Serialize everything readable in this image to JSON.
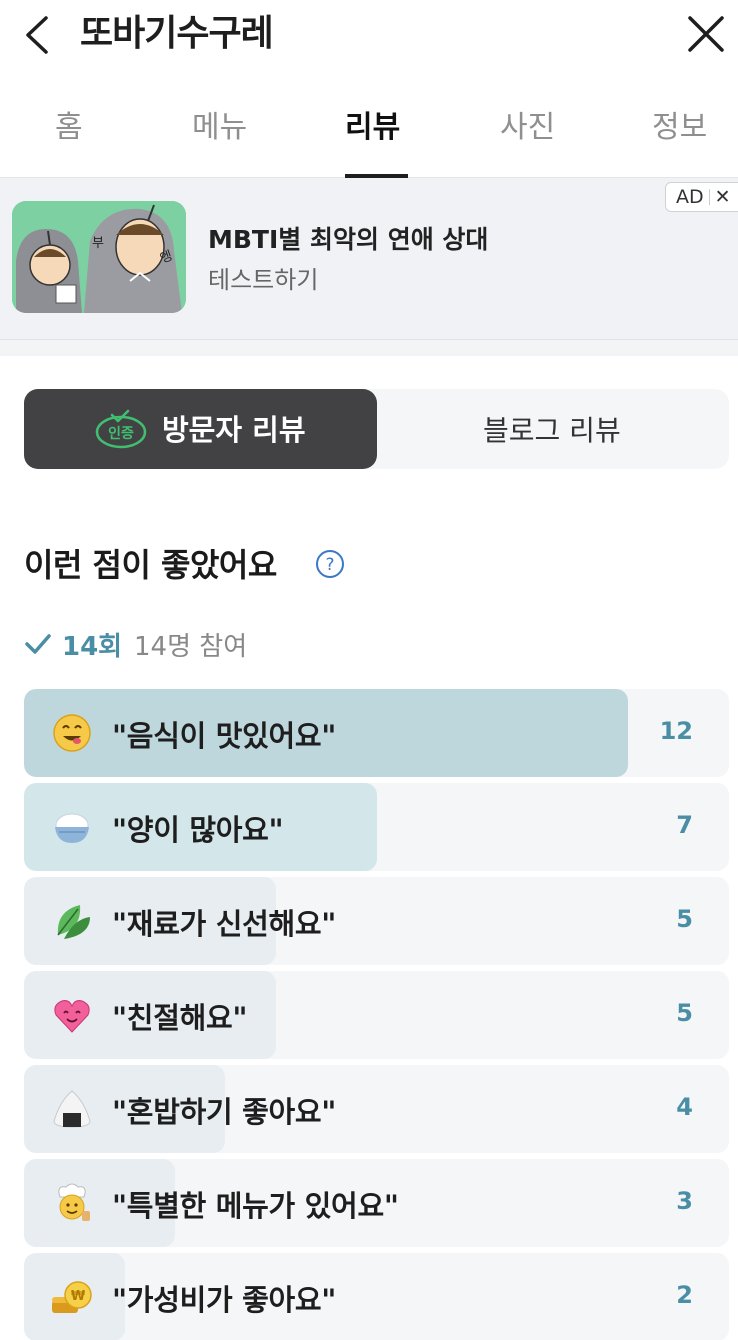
{
  "header": {
    "title": "또바기수구레"
  },
  "tabs": [
    {
      "label": "홈"
    },
    {
      "label": "메뉴"
    },
    {
      "label": "리뷰",
      "active": true
    },
    {
      "label": "사진"
    },
    {
      "label": "정보"
    }
  ],
  "ad": {
    "badge": "AD",
    "title": "MBTI별 최악의 연애 상대",
    "subtitle": "테스트하기",
    "thumb_text_1": "부",
    "thumb_text_2": "엥"
  },
  "segment": {
    "badge": "인증",
    "visitor_label": "방문자 리뷰",
    "blog_label": "블로그 리뷰"
  },
  "section": {
    "title": "이런 점이 좋았어요",
    "count": "14회",
    "participants": "14명 참여"
  },
  "total_participants": 14,
  "keywords": [
    {
      "label": "\"음식이 맛있어요\"",
      "count": 12,
      "icon": "yummy-face-icon"
    },
    {
      "label": "\"양이 많아요\"",
      "count": 7,
      "icon": "rice-bowl-icon"
    },
    {
      "label": "\"재료가 신선해요\"",
      "count": 5,
      "icon": "leaf-icon"
    },
    {
      "label": "\"친절해요\"",
      "count": 5,
      "icon": "heart-face-icon"
    },
    {
      "label": "\"혼밥하기 좋아요\"",
      "count": 4,
      "icon": "rice-ball-icon"
    },
    {
      "label": "\"특별한 메뉴가 있어요\"",
      "count": 3,
      "icon": "chef-icon"
    },
    {
      "label": "\"가성비가 좋아요\"",
      "count": 2,
      "icon": "coins-icon"
    }
  ],
  "colors": {
    "accent": "#4a8ea6",
    "bar_top": "#bdd7dd",
    "bar_second": "#d3e6ea",
    "bar_rest": "#e8edf1",
    "row_bg": "#f5f6f8",
    "segment_active": "#424244",
    "cert_green": "#3fbf6f"
  }
}
